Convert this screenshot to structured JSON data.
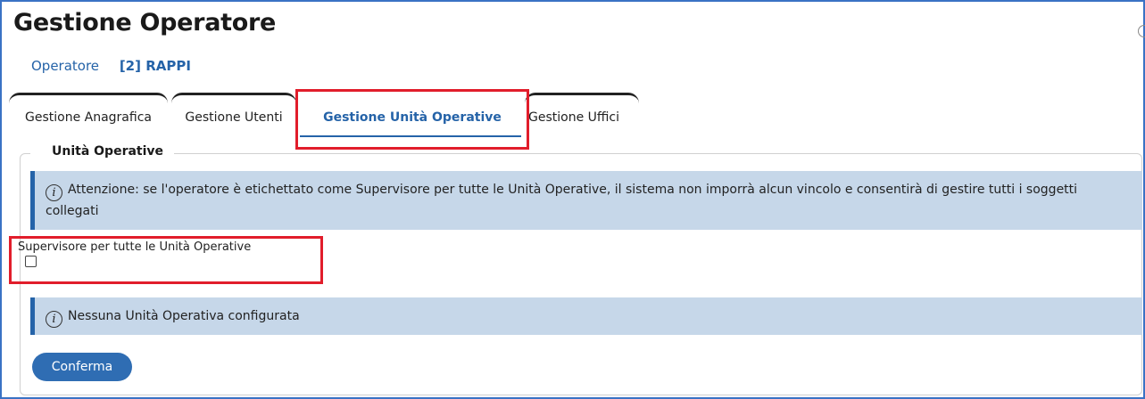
{
  "page": {
    "title": "Gestione Operatore"
  },
  "breadcrumb": {
    "section": "Operatore",
    "code": "[2] RAPPI"
  },
  "tabs": [
    {
      "label": "Gestione Anagrafica"
    },
    {
      "label": "Gestione Utenti"
    },
    {
      "label": "Gestione Unità Operative",
      "active": true
    },
    {
      "label": "Gestione Uffici"
    }
  ],
  "section": {
    "legend": "Unità Operative",
    "alert_supervisor": "Attenzione: se l'operatore è etichettato come Supervisore per tutte le Unità Operative, il sistema non imporrà alcun vincolo e consentirà di gestire tutti i soggetti collegati",
    "checkbox_label": "Supervisore per tutte le Unità Operative",
    "checkbox_checked": false,
    "alert_empty": "Nessuna Unità Operativa configurata",
    "confirm_label": "Conferma"
  },
  "icons": {
    "info": "info-icon"
  },
  "colors": {
    "accent": "#2563a8",
    "alert_bg": "#c6d7e9",
    "highlight": "#e11d2b",
    "button": "#2f6db3"
  }
}
